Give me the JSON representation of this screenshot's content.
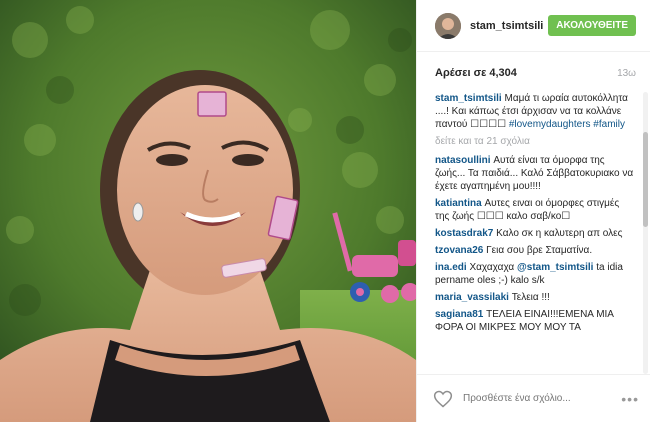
{
  "header": {
    "username": "stam_tsimtsili",
    "follow_label": "ΑΚΟΛΟΥΘΕΙΤΕ"
  },
  "stats": {
    "likes": "Αρέσει σε 4,304",
    "time": "13ω"
  },
  "caption": {
    "user": "stam_tsimtsili",
    "text": "Μαμά τι ωραία αυτοκόλλητα ....! Και κάπως έτσι άρχισαν να τα κολλάνε παντού",
    "emoji": "☐☐☐☐",
    "hashtags": "#lovemydaughters #family"
  },
  "more_comments": "δείτε και τα 21 σχόλια",
  "comments": [
    {
      "user": "natasoullini",
      "text": "Αυτά είναι τα όμορφα της ζωής... Τα παιδιά... Καλό Σάββατοκυριακο να έχετε αγαπημένη μου!!!!"
    },
    {
      "user": "katiantina",
      "text": "Αυτες ειναι οι όμορφες στιγμές της ζωής ☐☐☐ καλο σαβ/κο☐"
    },
    {
      "user": "kostasdrak7",
      "text": "Καλο σκ η καλυτερη απ ολες"
    },
    {
      "user": "tzovana26",
      "text": "Γεια σου βρε Σταματίνα."
    },
    {
      "user": "ina.edi",
      "text": "Χαχαχαχα",
      "mention": "@stam_tsimtsili",
      "text2": "ta idia pername oles ;-) kalo s/k"
    },
    {
      "user": "maria_vassilaki",
      "text": "Τελεια !!!"
    },
    {
      "user": "sagiana81",
      "text": "ΤΕΛΕΙΑ ΕΙΝΑΙ!!!ΕΜΕΝΑ ΜΙΑ ΦΟΡΑ ΟΙ ΜΙΚΡΕΣ ΜΟΥ ΜΟΥ ΤΑ"
    }
  ],
  "footer": {
    "placeholder": "Προσθέστε ένα σχόλιο...",
    "more_label": "•••"
  },
  "colors": {
    "follow_button": "#70c050",
    "username_link": "#125688",
    "muted": "#a5a7aa"
  },
  "icons": [
    "heart-icon",
    "more-options-icon"
  ]
}
